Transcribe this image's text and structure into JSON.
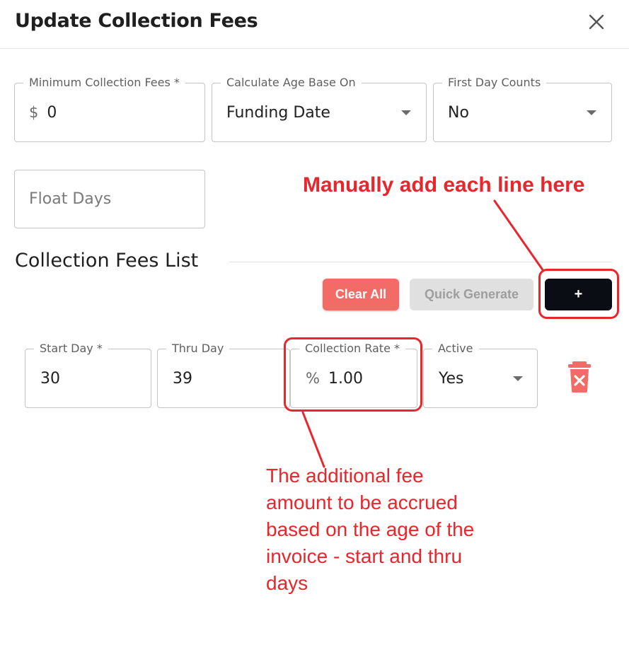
{
  "dialog": {
    "title": "Update Collection Fees"
  },
  "fields": {
    "min_fees": {
      "label": "Minimum Collection Fees *",
      "prefix": "$",
      "value": "0"
    },
    "age_base": {
      "label": "Calculate Age Base On",
      "value": "Funding Date"
    },
    "first_day": {
      "label": "First Day Counts",
      "value": "No"
    },
    "float_days": {
      "placeholder": "Float Days"
    }
  },
  "section": {
    "title": "Collection Fees List"
  },
  "buttons": {
    "clear_all": "Clear All",
    "quick_generate": "Quick Generate",
    "add": "+"
  },
  "fee_rows": [
    {
      "start_day": {
        "label": "Start Day *",
        "value": "30"
      },
      "thru_day": {
        "label": "Thru Day",
        "value": "39"
      },
      "rate": {
        "label": "Collection Rate *",
        "prefix": "%",
        "value": "1.00"
      },
      "active": {
        "label": "Active",
        "value": "Yes"
      }
    }
  ],
  "annotations": {
    "add_hint": "Manually add each line here",
    "rate_hint": "The additional fee amount to be accrued based on the age of the invoice - start and thru days"
  },
  "colors": {
    "annotation": "#e8262c",
    "clear_button": "#f26b66",
    "add_button": "#0a0d14",
    "trash": "#f26b66"
  },
  "icons": {
    "close": "close-icon",
    "trash": "trash-icon"
  }
}
